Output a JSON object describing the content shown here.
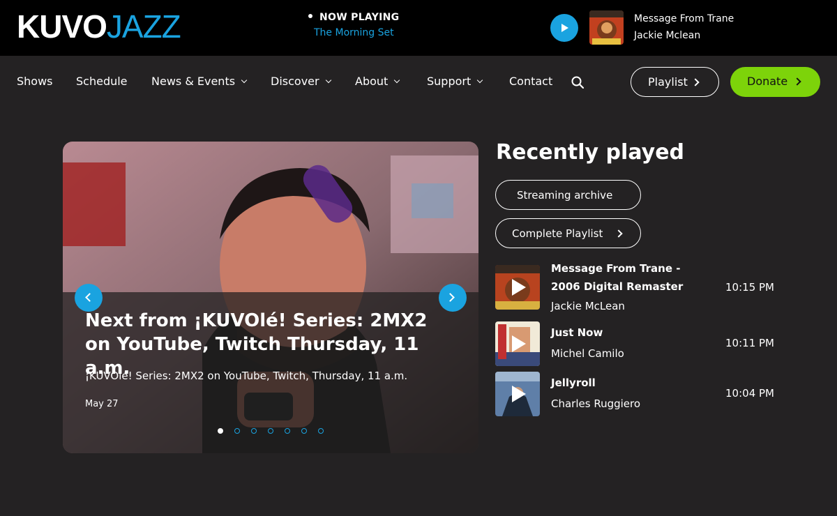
{
  "header": {
    "logo_part1": "KUVO",
    "logo_part2": "JAZZ",
    "now_playing_label": "NOW PLAYING",
    "now_playing_show": "The Morning Set",
    "current_track": "Message From Trane",
    "current_artist": "Jackie Mclean"
  },
  "nav": {
    "items": [
      {
        "label": "Shows"
      },
      {
        "label": "Schedule"
      },
      {
        "label": "News & Events"
      },
      {
        "label": "Discover"
      },
      {
        "label": "About"
      },
      {
        "label": "Support"
      },
      {
        "label": "Contact"
      }
    ],
    "playlist_label": "Playlist",
    "donate_label": "Donate"
  },
  "hero": {
    "title": "Next from ¡KUVOlé! Series: 2MX2 on YouTube, Twitch Thursday, 11 a.m.",
    "description": "¡KUVOlé! Series: 2MX2 on YouTube, Twitch, Thursday, 11 a.m.",
    "date": "May 27",
    "slide_count": 7,
    "active_slide": 1
  },
  "recently_played": {
    "title": "Recently played",
    "streaming_archive_label": "Streaming archive",
    "complete_playlist_label": "Complete Playlist",
    "tracks": [
      {
        "track": "Message From Trane - 2006 Digital Remaster",
        "artist": "Jackie McLean",
        "time": "10:15 PM"
      },
      {
        "track": "Just Now",
        "artist": "Michel Camilo",
        "time": "10:11 PM"
      },
      {
        "track": "Jellyroll",
        "artist": "Charles Ruggiero",
        "time": "10:04 PM"
      }
    ]
  },
  "colors": {
    "accent_blue": "#1aa3e0",
    "donate_green": "#7dd30a",
    "background": "#242223"
  }
}
